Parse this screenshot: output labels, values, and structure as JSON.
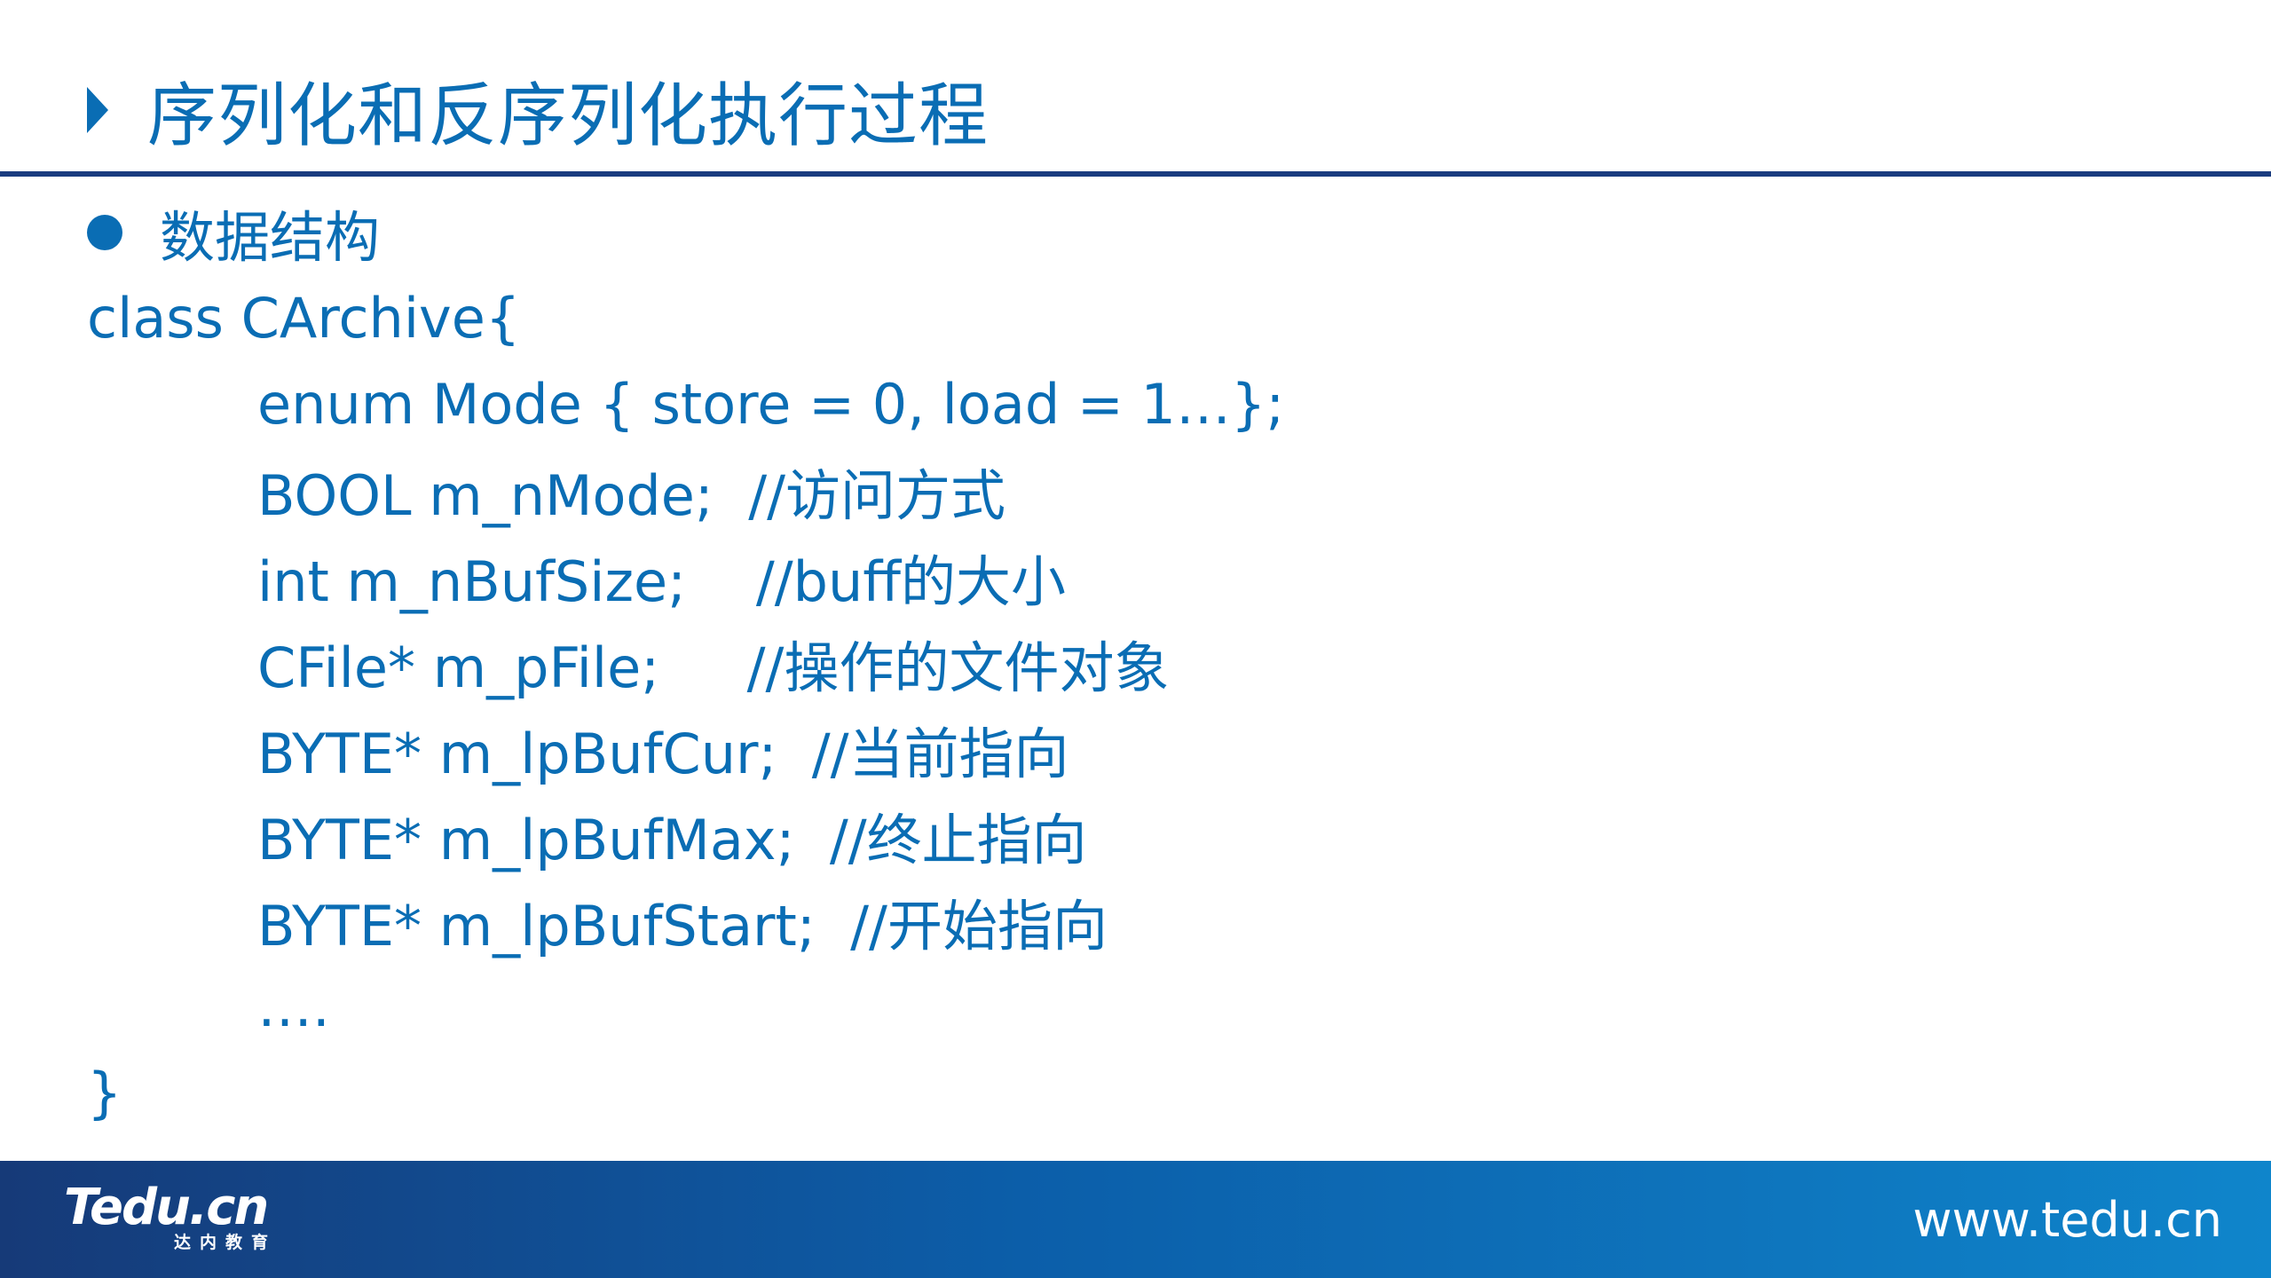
{
  "slide": {
    "title": "序列化和反序列化执行过程"
  },
  "content": {
    "bullet": "数据结构",
    "class_open": "class CArchive{",
    "members": [
      "enum Mode { store = 0, load = 1…};",
      "BOOL m_nMode;  //访问方式",
      "int m_nBufSize;    //buff的大小",
      "CFile* m_pFile;     //操作的文件对象",
      "BYTE* m_lpBufCur;  //当前指向",
      "BYTE* m_lpBufMax;  //终止指向",
      "BYTE* m_lpBufStart;  //开始指向",
      "…."
    ],
    "class_close": "}"
  },
  "footer": {
    "logo_main": "Tedu.cn",
    "logo_sub": "达内教育",
    "url": "www.tedu.cn"
  },
  "colors": {
    "text_blue": "#0a6db4",
    "rule_navy": "#1a3c7f",
    "footer_dark": "#163a78",
    "footer_light": "#0f85cb"
  }
}
